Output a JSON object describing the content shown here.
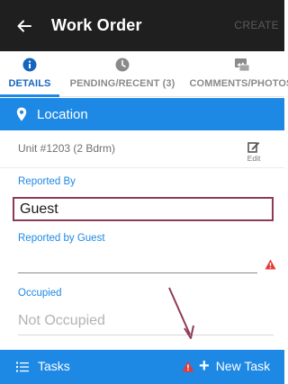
{
  "appbar": {
    "title": "Work Order",
    "action_label": "CREATE"
  },
  "tabs": [
    {
      "label": "DETAILS",
      "icon": "info-icon",
      "active": true
    },
    {
      "label": "PENDING/RECENT (3)",
      "icon": "clock-icon",
      "active": false
    },
    {
      "label": "COMMENTS/PHOTOS",
      "icon": "photo-icon",
      "active": false
    }
  ],
  "location": {
    "label": "Location",
    "icon": "pin-icon"
  },
  "unit": {
    "text": "Unit #1203 (2 Bdrm)",
    "edit_label": "Edit"
  },
  "reported_by": {
    "label": "Reported By",
    "value": "Guest"
  },
  "reported_by_guest": {
    "label": "Reported by Guest",
    "value": ""
  },
  "occupied": {
    "label": "Occupied",
    "placeholder": "Not Occupied"
  },
  "bottom_bar": {
    "tasks_label": "Tasks",
    "new_task_label": "New Task"
  },
  "colors": {
    "accent": "#1e88e5",
    "appbar": "#1f1f1f",
    "warning": "#e53935",
    "highlight": "#8e3b54"
  }
}
